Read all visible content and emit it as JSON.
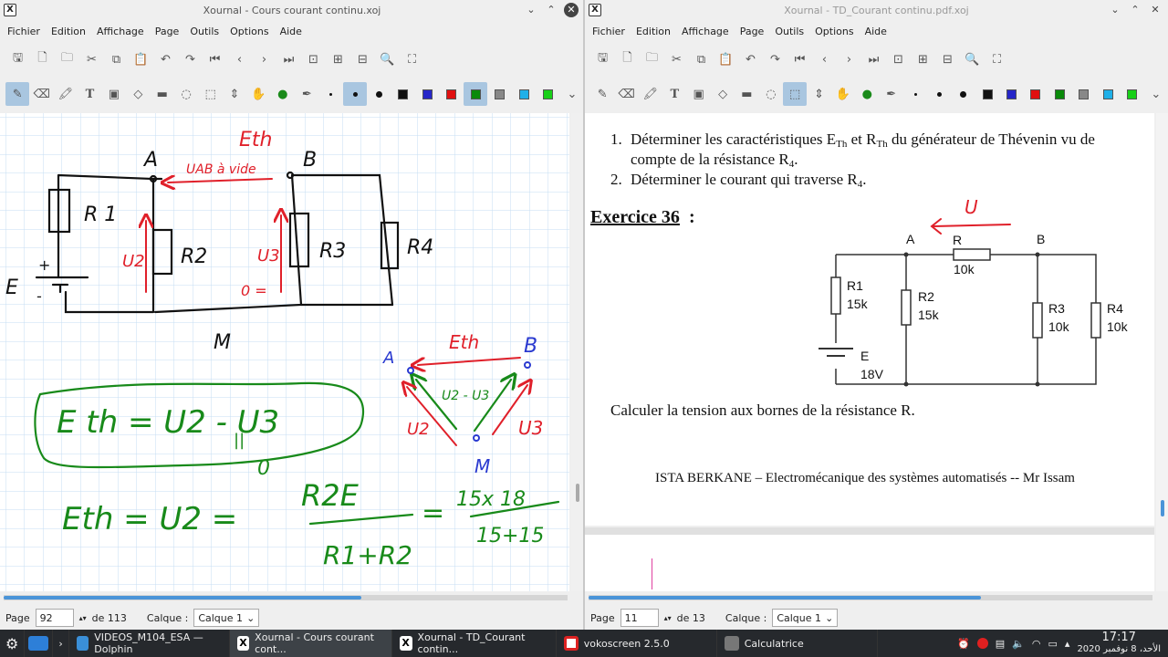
{
  "left_window": {
    "title": "Xournal - Cours courant continu.xoj",
    "app_icon": "X",
    "menu": [
      "Fichier",
      "Edition",
      "Affichage",
      "Page",
      "Outils",
      "Options",
      "Aide"
    ],
    "status": {
      "page_label": "Page",
      "page_value": "92",
      "of_label": "de 113",
      "layer_label": "Calque :",
      "layer_value": "Calque 1"
    },
    "handwriting": {
      "eth_top": "Eth",
      "uab_vide": "UAB à vide",
      "A": "A",
      "B": "B",
      "R1": "R 1",
      "R2": "R2",
      "R3": "R3",
      "R4": "R4",
      "E": "E",
      "plus": "+",
      "minus": "-",
      "U2": "U2",
      "U3": "U3",
      "zero_eq": "0 =",
      "M": "M",
      "eq1_main": "E th = U2 - U3",
      "eq1_slashes": "||",
      "eq1_zero": "0",
      "eq2_lhs": "Eth = U2 =",
      "eq2_num": "R2E",
      "eq2_den": "R1+R2",
      "eq2_eq": "=",
      "eq2_num2": "15x 18",
      "eq2_den2": "15+15",
      "d_A": "A",
      "d_B": "B",
      "d_Eth": "Eth",
      "d_U2_mid": "U2 - U3",
      "d_U2": "U2",
      "d_U3": "U3",
      "d_M": "M"
    }
  },
  "right_window": {
    "title": "Xournal - TD_Courant continu.pdf.xoj",
    "app_icon": "X",
    "menu": [
      "Fichier",
      "Edition",
      "Affichage",
      "Page",
      "Outils",
      "Options",
      "Aide"
    ],
    "status": {
      "page_label": "Page",
      "page_value": "11",
      "of_label": "de 13",
      "layer_label": "Calque :",
      "layer_value": "Calque 1"
    },
    "doc": {
      "item1_num": "1.",
      "item1_a": "Déterminer les caractéristiques E",
      "item1_sub1": "Th",
      "item1_b": " et R",
      "item1_sub2": "Th",
      "item1_c": " du générateur de Thévenin vu de",
      "item1_line2": "compte de la résistance R",
      "item1_line2_sub": "4",
      "item1_line2_end": ".",
      "item2_num": "2.",
      "item2": "Déterminer le courant qui traverse R",
      "item2_sub": "4",
      "item2_end": ".",
      "exercise_title": "Exercice 36",
      "exercise_colon": " :",
      "circuit": {
        "A": "A",
        "B": "B",
        "R": "R",
        "R_val": "10k",
        "R1": "R1",
        "R1_val": "15k",
        "R2": "R2",
        "R2_val": "15k",
        "R3": "R3",
        "R3_val": "10k",
        "R4": "R4",
        "R4_val": "10k",
        "E": "E",
        "E_val": "18V"
      },
      "handwritten_U": "U",
      "question": "Calculer la tension aux bornes de la résistance R.",
      "footer": "ISTA BERKANE – Electromécanique des systèmes automatisés -- Mr Issam"
    }
  },
  "taskbar": {
    "tasks": [
      "VIDEOS_M104_ESA — Dolphin",
      "Xournal - Cours courant cont...",
      "Xournal - TD_Courant contin...",
      "vokoscreen 2.5.0",
      "Calculatrice"
    ],
    "time": "17:17",
    "date": "الأحد، 8 نوفمبر 2020"
  },
  "colors": {
    "ink_black": "#111111",
    "ink_red": "#e0202a",
    "ink_green": "#188a1a",
    "ink_blue": "#2a3ad0",
    "grid": "#c6ddf3",
    "margin_red": "#e38080"
  }
}
